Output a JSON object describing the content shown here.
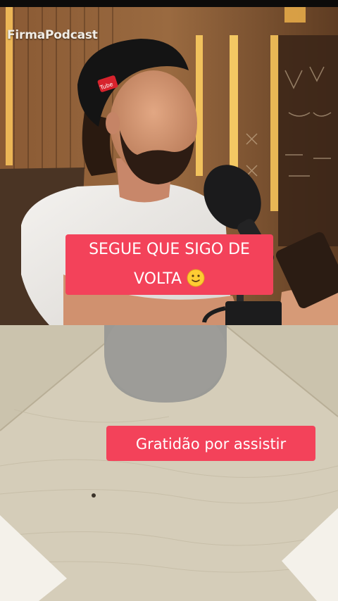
{
  "watermark": {
    "text": "FirmaPodcast"
  },
  "captions": {
    "top_text_line1": "SEGUE QUE SIGO DE",
    "top_text_line2": "VOLTA",
    "top_emoji": "slightly-smiling-face-icon",
    "bottom_text": "Gratidão por assistir"
  },
  "cap_logo_text": "Tube",
  "colors": {
    "caption_bg": "#f3425a",
    "caption_text": "#ffffff",
    "watermark_text": "#f1ede6"
  }
}
